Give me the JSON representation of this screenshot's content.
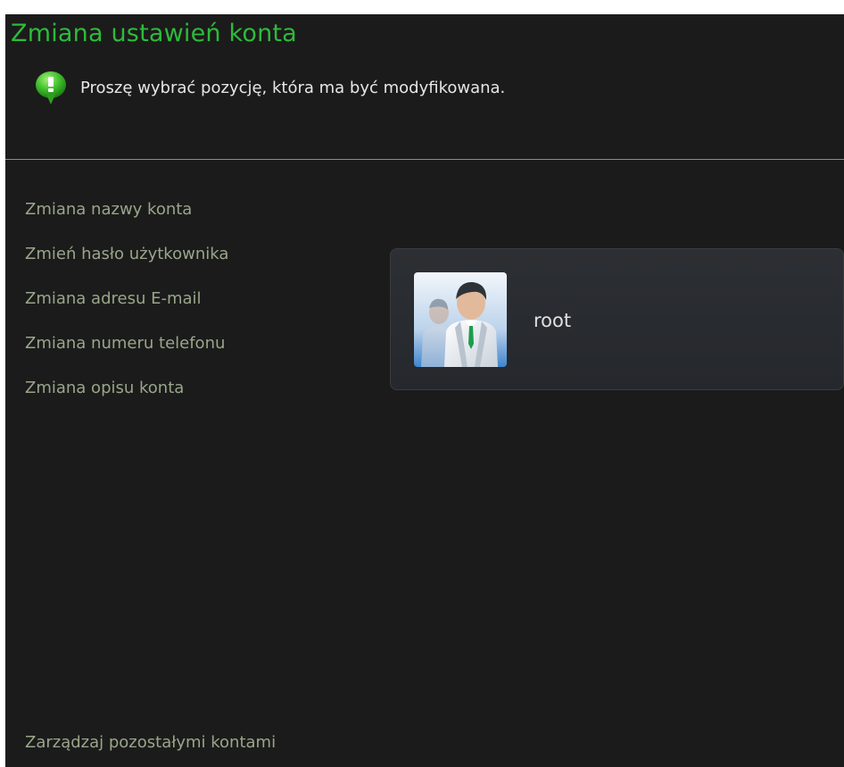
{
  "page": {
    "title": "Zmiana ustawień konta",
    "info_text": "Proszę wybrać pozycję, która ma być modyfikowana."
  },
  "menu": {
    "items": [
      {
        "label": "Zmiana nazwy konta"
      },
      {
        "label": "Zmień hasło użytkownika"
      },
      {
        "label": "Zmiana adresu E-mail"
      },
      {
        "label": "Zmiana numeru telefonu"
      },
      {
        "label": "Zmiana opisu konta"
      }
    ]
  },
  "account": {
    "name": "root",
    "avatar_icon": "user-avatar-icon"
  },
  "footer": {
    "manage_link": "Zarządzaj pozostałymi kontami"
  },
  "colors": {
    "title": "#2dbb3a",
    "background": "#1b1b1b",
    "menu_text": "#9aa58a",
    "card": "#2c2f33"
  },
  "icons": {
    "info": "info-bubble-icon"
  }
}
